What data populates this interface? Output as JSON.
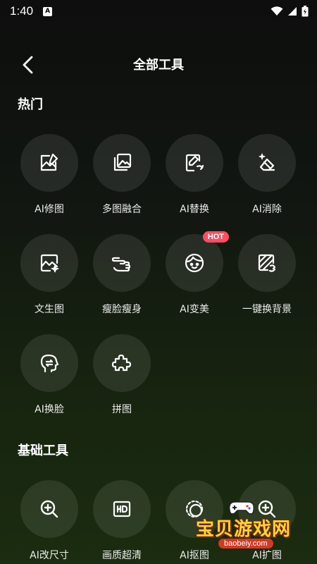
{
  "status_bar": {
    "time": "1:40",
    "notification_icon_letter": "A"
  },
  "header": {
    "title": "全部工具",
    "back_icon": "chevron-left-icon"
  },
  "sections": {
    "hot": {
      "title": "热门",
      "tools": [
        {
          "label": "AI修图",
          "icon": "image-edit-icon"
        },
        {
          "label": "多图融合",
          "icon": "image-stack-icon"
        },
        {
          "label": "AI替换",
          "icon": "document-edit-icon"
        },
        {
          "label": "AI消除",
          "icon": "eraser-icon"
        },
        {
          "label": "文生图",
          "icon": "image-sparkle-icon"
        },
        {
          "label": "瘦脸瘦身",
          "icon": "hand-pointer-icon"
        },
        {
          "label": "AI变美",
          "icon": "face-icon",
          "badge": "HOT"
        },
        {
          "label": "一键换背景",
          "icon": "background-swap-icon"
        },
        {
          "label": "AI换脸",
          "icon": "head-swap-icon"
        },
        {
          "label": "拼图",
          "icon": "puzzle-icon"
        }
      ]
    },
    "basic": {
      "title": "基础工具",
      "tools": [
        {
          "label": "AI改尺寸",
          "icon": "zoom-in-icon"
        },
        {
          "label": "画质超清",
          "icon": "hd-icon"
        },
        {
          "label": "AI抠图",
          "icon": "cutout-icon"
        },
        {
          "label": "AI扩图",
          "icon": "zoom-in-icon"
        }
      ]
    }
  },
  "watermark": {
    "text": "宝贝游戏网",
    "url": "baobeiy.com"
  },
  "colors": {
    "background": "#111611",
    "circle": "#2a2f29",
    "hot_badge": "#ff4d63",
    "text": "#ffffff"
  }
}
